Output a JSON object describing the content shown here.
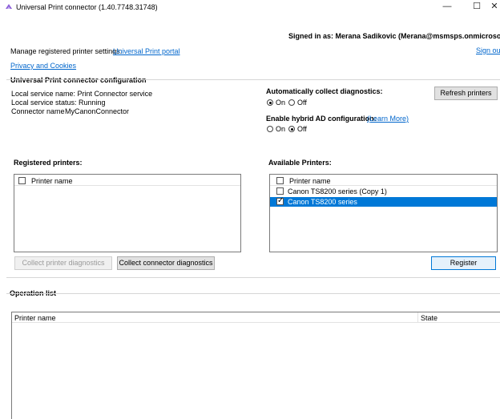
{
  "window": {
    "title": "Universal Print connector (1.40.7748.31748)",
    "minimize": "—",
    "maximize": "☐",
    "close": "✕"
  },
  "header": {
    "signed_in_label": "Signed in as: Merana Sadikovic (Merana@msmsps.onmicrosoft.com)",
    "sign_out": "Sign out",
    "manage_label": "Manage registered printer settings:",
    "portal_link": "Universal Print portal",
    "privacy_link": "Privacy and Cookies"
  },
  "config": {
    "section_title": "Universal Print connector configuration",
    "service_name": "Local service name: Print Connector service",
    "service_status": "Local service status: Running",
    "connector_name_label": "Connector name",
    "connector_name_value": "MyCanonConnector",
    "auto_diag_label": "Automatically collect diagnostics:",
    "auto_diag_on": "On",
    "auto_diag_off": "Off",
    "auto_diag_selected": "On",
    "hybrid_label": "Enable hybrid AD configuration:",
    "hybrid_learn_more": "(Learn More)",
    "hybrid_on": "On",
    "hybrid_off": "Off",
    "hybrid_selected": "Off",
    "refresh_button": "Refresh printers"
  },
  "registered": {
    "title": "Registered printers:",
    "column": "Printer name",
    "items": []
  },
  "available": {
    "title": "Available Printers:",
    "column": "Printer name",
    "items": [
      {
        "name": "Canon TS8200 series (Copy 1)",
        "checked": false,
        "selected": false
      },
      {
        "name": "Canon TS8200 series",
        "checked": true,
        "selected": true
      }
    ]
  },
  "buttons": {
    "collect_printer_diag": "Collect printer diagnostics",
    "collect_connector_diag": "Collect connector diagnostics",
    "register": "Register"
  },
  "operations": {
    "title": "Operation list",
    "col_printer": "Printer name",
    "col_state": "State"
  },
  "colors": {
    "accent": "#0078d7",
    "link": "#0066cc"
  }
}
